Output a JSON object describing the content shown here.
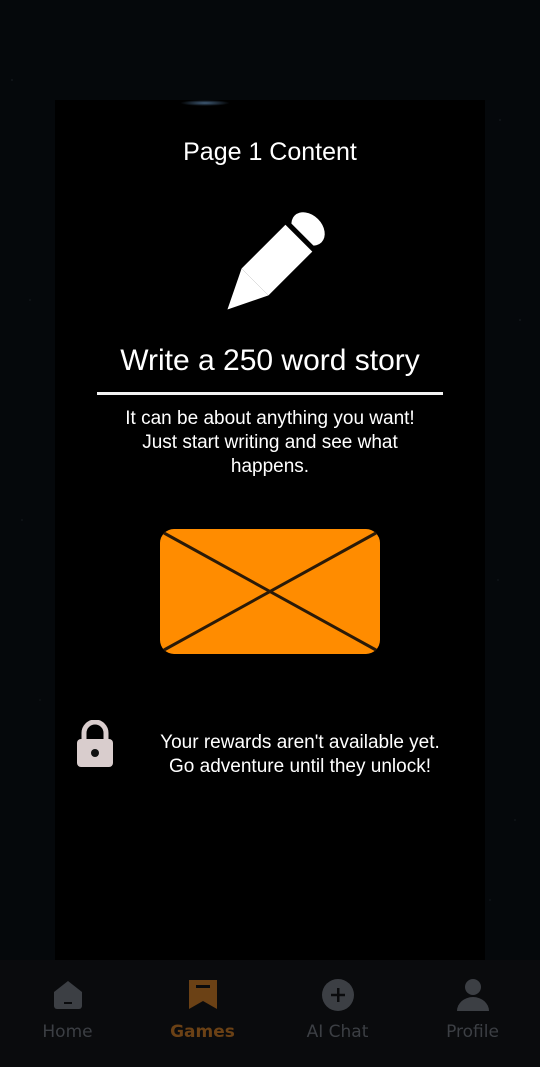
{
  "page": {
    "title": "Page 1 Content"
  },
  "prompt": {
    "title": "Write a 250 word story",
    "description": "It can be about anything you want! Just start writing and see what happens."
  },
  "rewards": {
    "message_line1": "Your rewards aren't available yet.",
    "message_line2": "Go adventure until they unlock!"
  },
  "nav": {
    "items": [
      {
        "label": "Home",
        "icon": "home-icon",
        "active": false
      },
      {
        "label": "Games",
        "icon": "bookmark-icon",
        "active": true
      },
      {
        "label": "AI Chat",
        "icon": "plus-circle-icon",
        "active": false
      },
      {
        "label": "Profile",
        "icon": "person-icon",
        "active": false
      }
    ]
  },
  "colors": {
    "envelope": "#ff8c00",
    "active_tab": "#6b4115",
    "inactive_tab": "#3c3f44",
    "lock": "#d9cdcd"
  }
}
